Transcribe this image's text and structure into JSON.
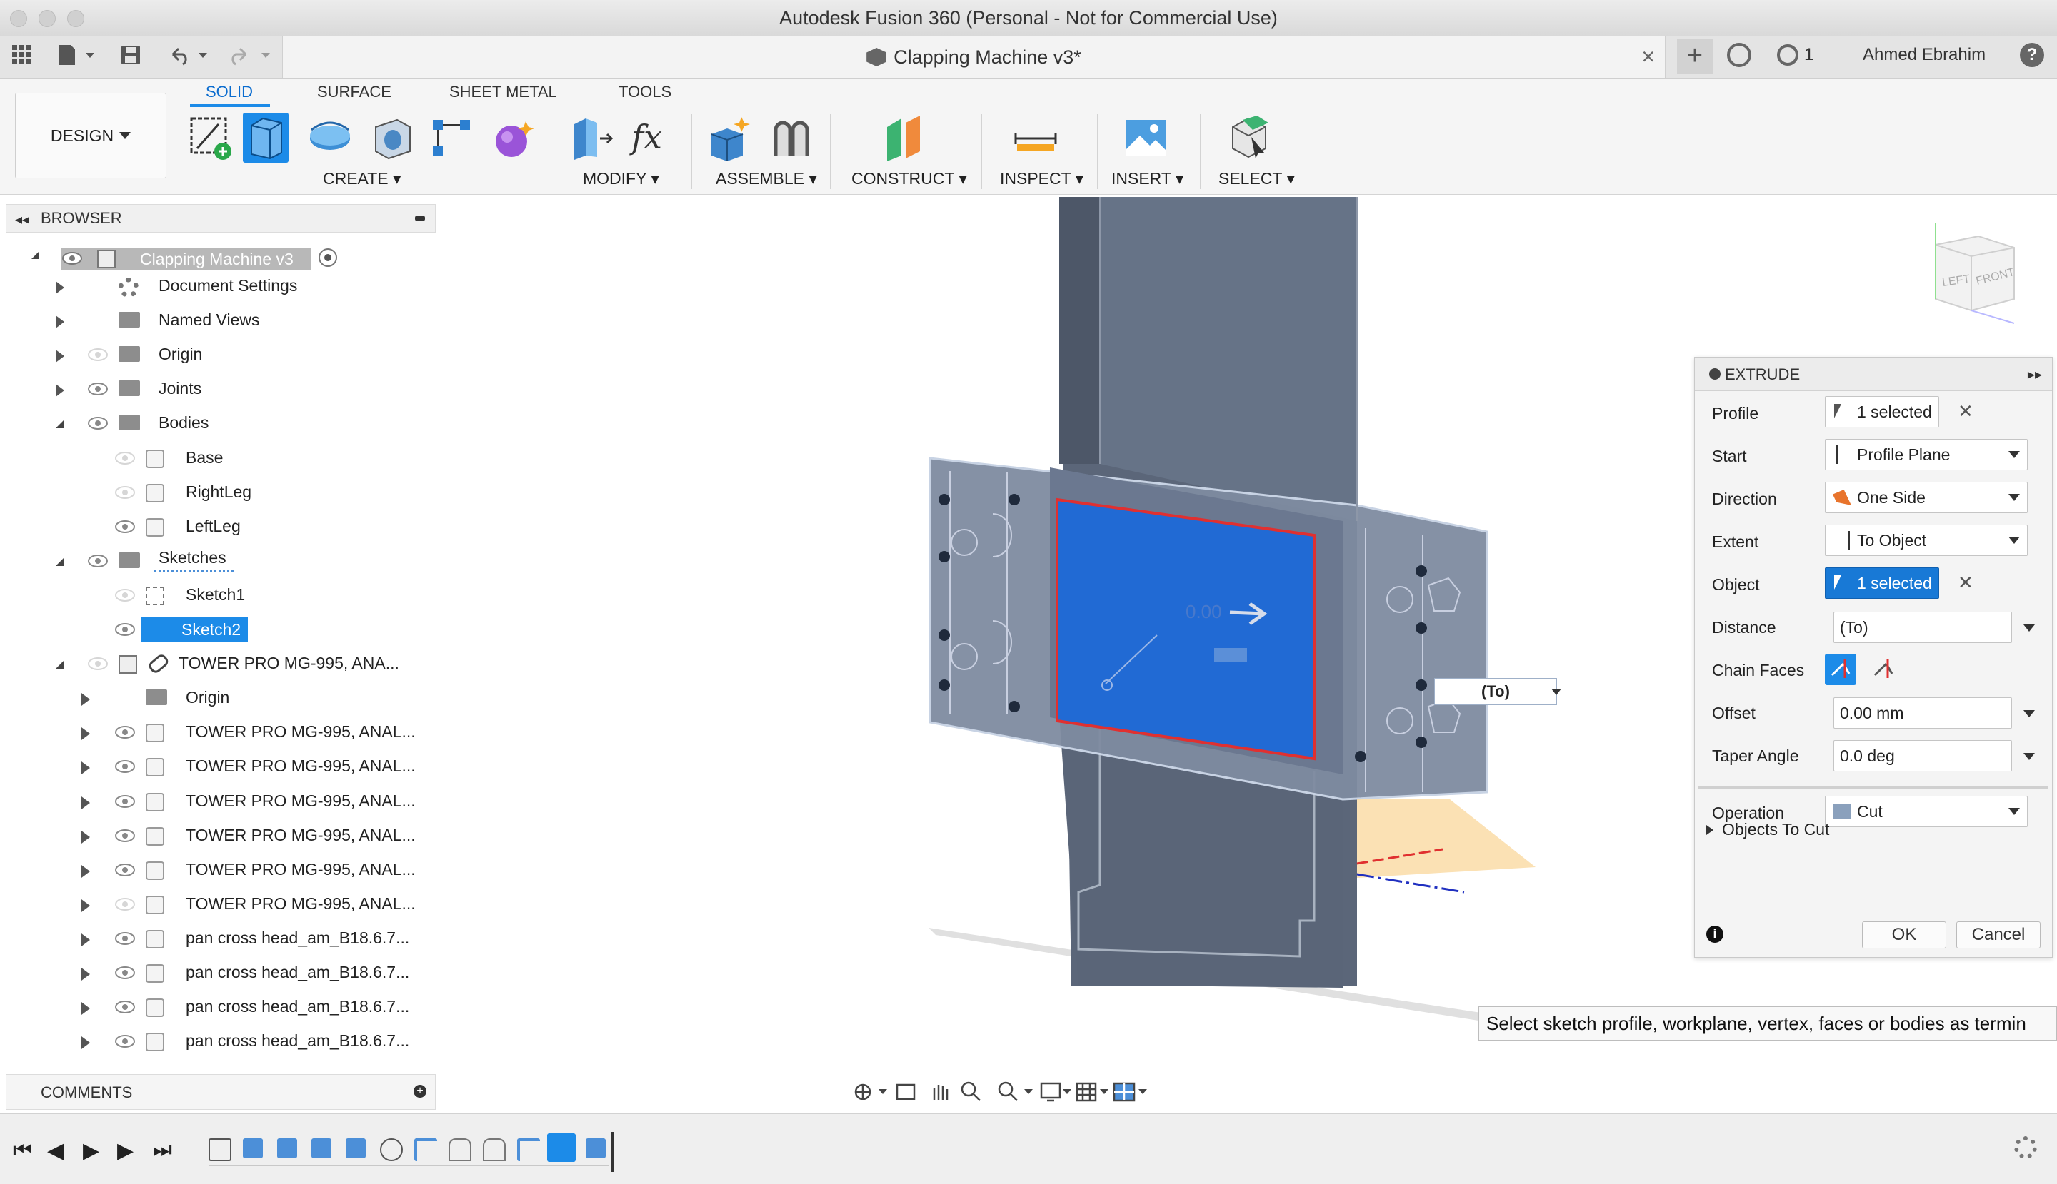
{
  "window": {
    "title": "Autodesk Fusion 360 (Personal - Not for Commercial Use)"
  },
  "tabbar": {
    "doc_title": "Clapping Machine v3*",
    "job_count": "1",
    "user": "Ahmed Ebrahim"
  },
  "ribbon": {
    "workspace": "DESIGN",
    "tabs": [
      {
        "label": "SOLID"
      },
      {
        "label": "SURFACE"
      },
      {
        "label": "SHEET METAL"
      },
      {
        "label": "TOOLS"
      }
    ],
    "groups": [
      {
        "label": "CREATE"
      },
      {
        "label": "MODIFY"
      },
      {
        "label": "ASSEMBLE"
      },
      {
        "label": "CONSTRUCT"
      },
      {
        "label": "INSPECT"
      },
      {
        "label": "INSERT"
      },
      {
        "label": "SELECT"
      }
    ]
  },
  "browser": {
    "title": "BROWSER",
    "root": "Clapping Machine v3",
    "items": [
      {
        "label": "Document Settings"
      },
      {
        "label": "Named Views"
      },
      {
        "label": "Origin"
      },
      {
        "label": "Joints"
      },
      {
        "label": "Bodies"
      },
      {
        "label": "Base"
      },
      {
        "label": "RightLeg"
      },
      {
        "label": "LeftLeg"
      },
      {
        "label": "Sketches"
      },
      {
        "label": "Sketch1"
      },
      {
        "label": "Sketch2"
      },
      {
        "label": "TOWER PRO MG-995, ANA..."
      },
      {
        "label": "Origin"
      },
      {
        "label": "TOWER PRO MG-995, ANAL..."
      },
      {
        "label": "TOWER PRO MG-995, ANAL..."
      },
      {
        "label": "TOWER PRO MG-995, ANAL..."
      },
      {
        "label": "TOWER PRO MG-995, ANAL..."
      },
      {
        "label": "TOWER PRO MG-995, ANAL..."
      },
      {
        "label": "TOWER PRO MG-995, ANAL..."
      },
      {
        "label": "pan cross head_am_B18.6.7..."
      },
      {
        "label": "pan cross head_am_B18.6.7..."
      },
      {
        "label": "pan cross head_am_B18.6.7..."
      },
      {
        "label": "pan cross head_am_B18.6.7..."
      }
    ]
  },
  "comments": {
    "title": "COMMENTS"
  },
  "viewport": {
    "dim_value": "(To)",
    "dim_faint": "0.00",
    "viewcube": {
      "left": "LEFT",
      "front": "FRONT"
    }
  },
  "extrude": {
    "title": "EXTRUDE",
    "profile": {
      "label": "Profile",
      "value": "1 selected"
    },
    "start": {
      "label": "Start",
      "value": "Profile Plane"
    },
    "direction": {
      "label": "Direction",
      "value": "One Side"
    },
    "extent": {
      "label": "Extent",
      "value": "To Object"
    },
    "object": {
      "label": "Object",
      "value": "1 selected"
    },
    "distance": {
      "label": "Distance",
      "value": "(To)"
    },
    "chain_faces": {
      "label": "Chain Faces"
    },
    "offset": {
      "label": "Offset",
      "value": "0.00 mm"
    },
    "taper": {
      "label": "Taper Angle",
      "value": "0.0 deg"
    },
    "operation": {
      "label": "Operation",
      "value": "Cut"
    },
    "objects_to_cut": "Objects To Cut",
    "ok": "OK",
    "cancel": "Cancel"
  },
  "tooltip": "Select sketch profile, workplane, vertex, faces or bodies as termin",
  "colors": {
    "accent": "#1c8be8",
    "selection": "#1879d6",
    "model": "#5a6a80"
  }
}
